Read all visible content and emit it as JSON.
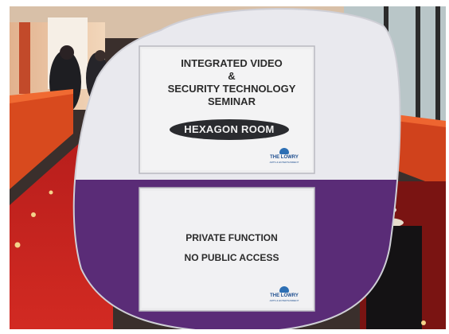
{
  "sign": {
    "upper_panel": {
      "title_lines": [
        "INTEGRATED VIDEO",
        "&",
        "SECURITY TECHNOLOGY",
        "SEMINAR"
      ],
      "room_label": "HEXAGON ROOM",
      "logo_text": "THE LOWRY",
      "logo_subtext": "ARTS & ENTERTAINMENT"
    },
    "lower_panel": {
      "lines": [
        "PRIVATE FUNCTION",
        "NO PUBLIC ACCESS"
      ],
      "logo_text": "THE LOWRY",
      "logo_subtext": "ARTS & ENTERTAINMENT"
    }
  },
  "colors": {
    "sign_white": "#e9e9ee",
    "sign_purple": "#5a2c77",
    "carpet_red": "#c8201e",
    "rail_orange": "#d84a1e",
    "room_pill": "#2a2b2f",
    "logo_blue": "#2d6fb4"
  }
}
